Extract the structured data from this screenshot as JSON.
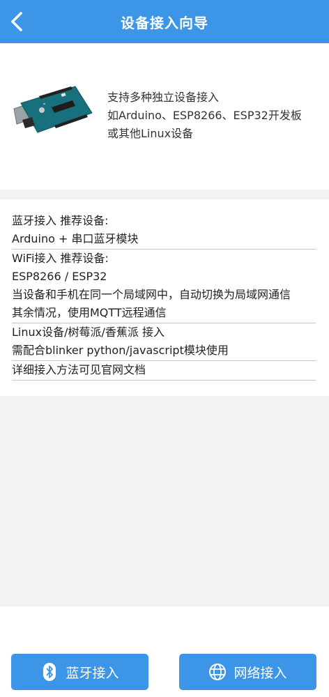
{
  "header": {
    "title": "设备接入向导",
    "back_icon": "chevron-left-icon"
  },
  "intro": {
    "image": "arduino-board-image",
    "lines": [
      "支持多种独立设备接入",
      "如Arduino、ESP8266、ESP32开发板",
      "或其他Linux设备"
    ]
  },
  "info": {
    "rows": [
      "蓝牙接入 推荐设备:",
      "Arduino + 串口蓝牙模块",
      "WiFi接入 推荐设备:",
      "ESP8266 / ESP32",
      "当设备和手机在同一个局域网中，自动切换为局域网通信",
      "其余情况，使用MQTT远程通信",
      "Linux设备/树莓派/香蕉派 接入",
      "需配合blinker python/javascript模块使用",
      "详细接入方法可见官网文档"
    ]
  },
  "buttons": {
    "bluetooth_label": "蓝牙接入",
    "bluetooth_icon": "bluetooth-icon",
    "network_label": "网络接入",
    "network_icon": "globe-icon"
  },
  "colors": {
    "primary": "#3d95e8",
    "background": "#f2f2f2"
  }
}
